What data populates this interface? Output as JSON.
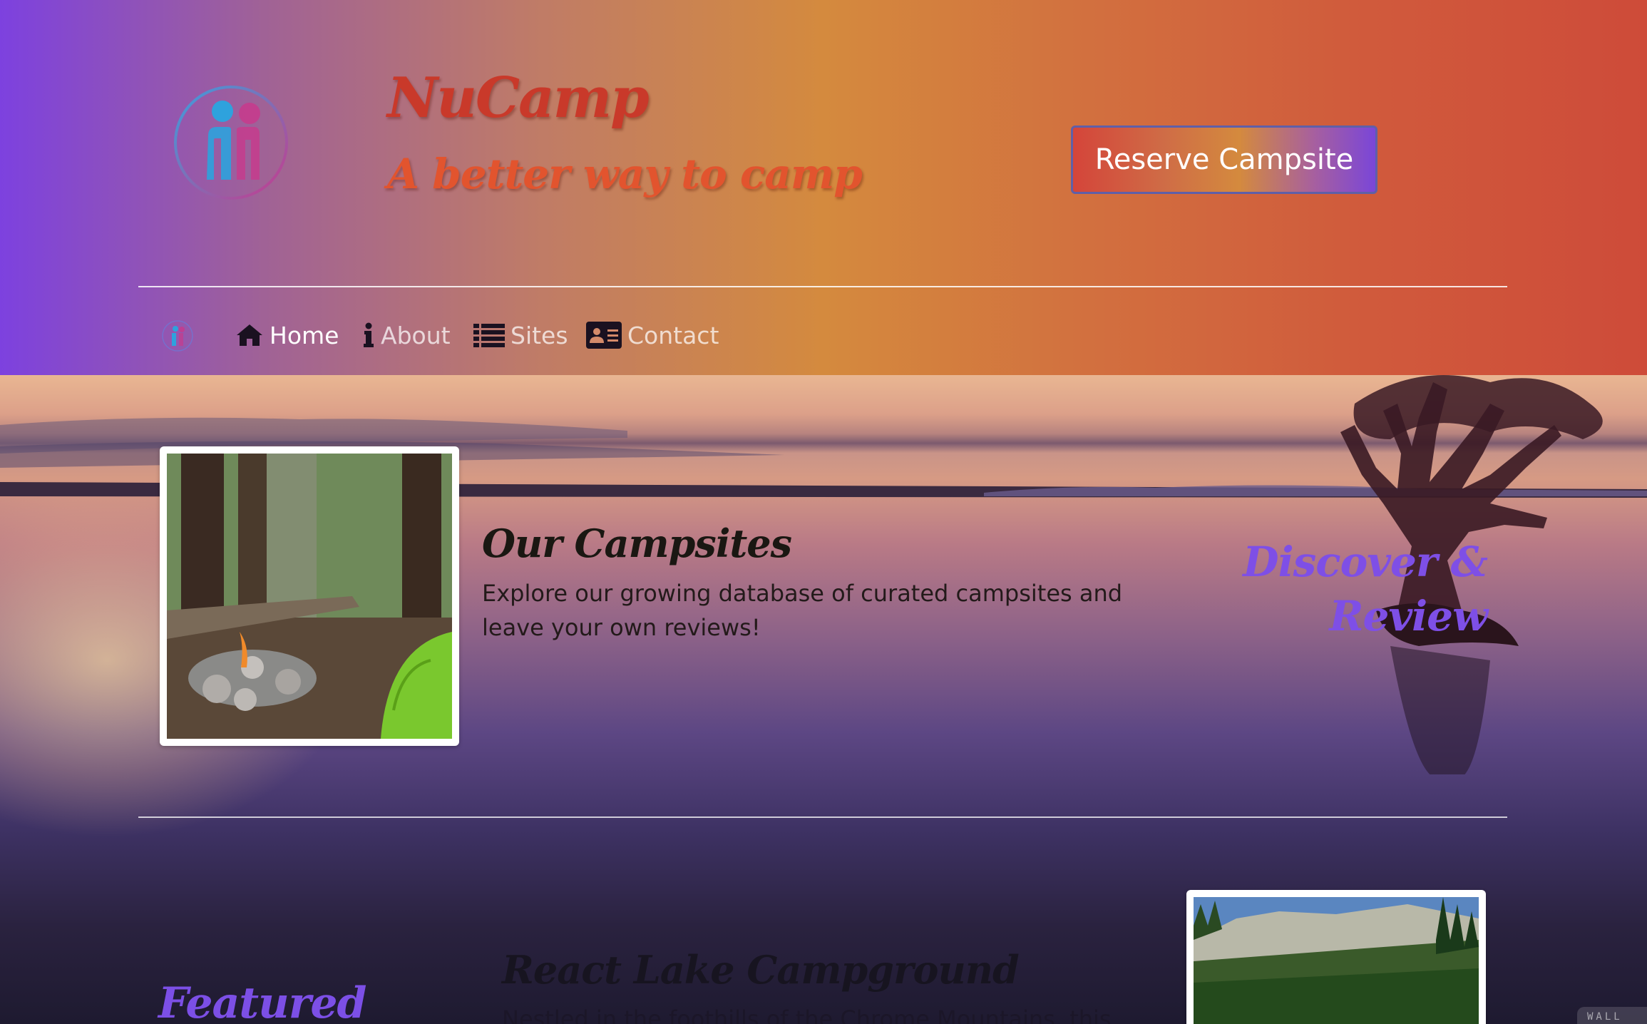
{
  "header": {
    "brand_title": "NuCamp",
    "brand_tagline": "A better way to camp",
    "reserve_label": "Reserve Campsite"
  },
  "nav": {
    "items": [
      {
        "label": "Home",
        "icon": "home-icon",
        "active": true
      },
      {
        "label": "About",
        "icon": "info-icon",
        "active": false
      },
      {
        "label": "Sites",
        "icon": "list-icon",
        "active": false
      },
      {
        "label": "Contact",
        "icon": "address-card-icon",
        "active": false
      }
    ]
  },
  "campsites": {
    "title": "Our Campsites",
    "description": "Explore our growing database of curated campsites and leave your own reviews!",
    "tagline_line1": "Discover &",
    "tagline_line2": "Review"
  },
  "featured": {
    "heading": "Featured",
    "title": "React Lake Campground",
    "description_fragment": "Nestled in the foothills of the Chrome Mountains, this"
  },
  "watermark": "WALL",
  "colors": {
    "accent_purple": "#7e4fe6",
    "brand_red": "#c9392a",
    "tagline_orange": "#e2542e"
  }
}
